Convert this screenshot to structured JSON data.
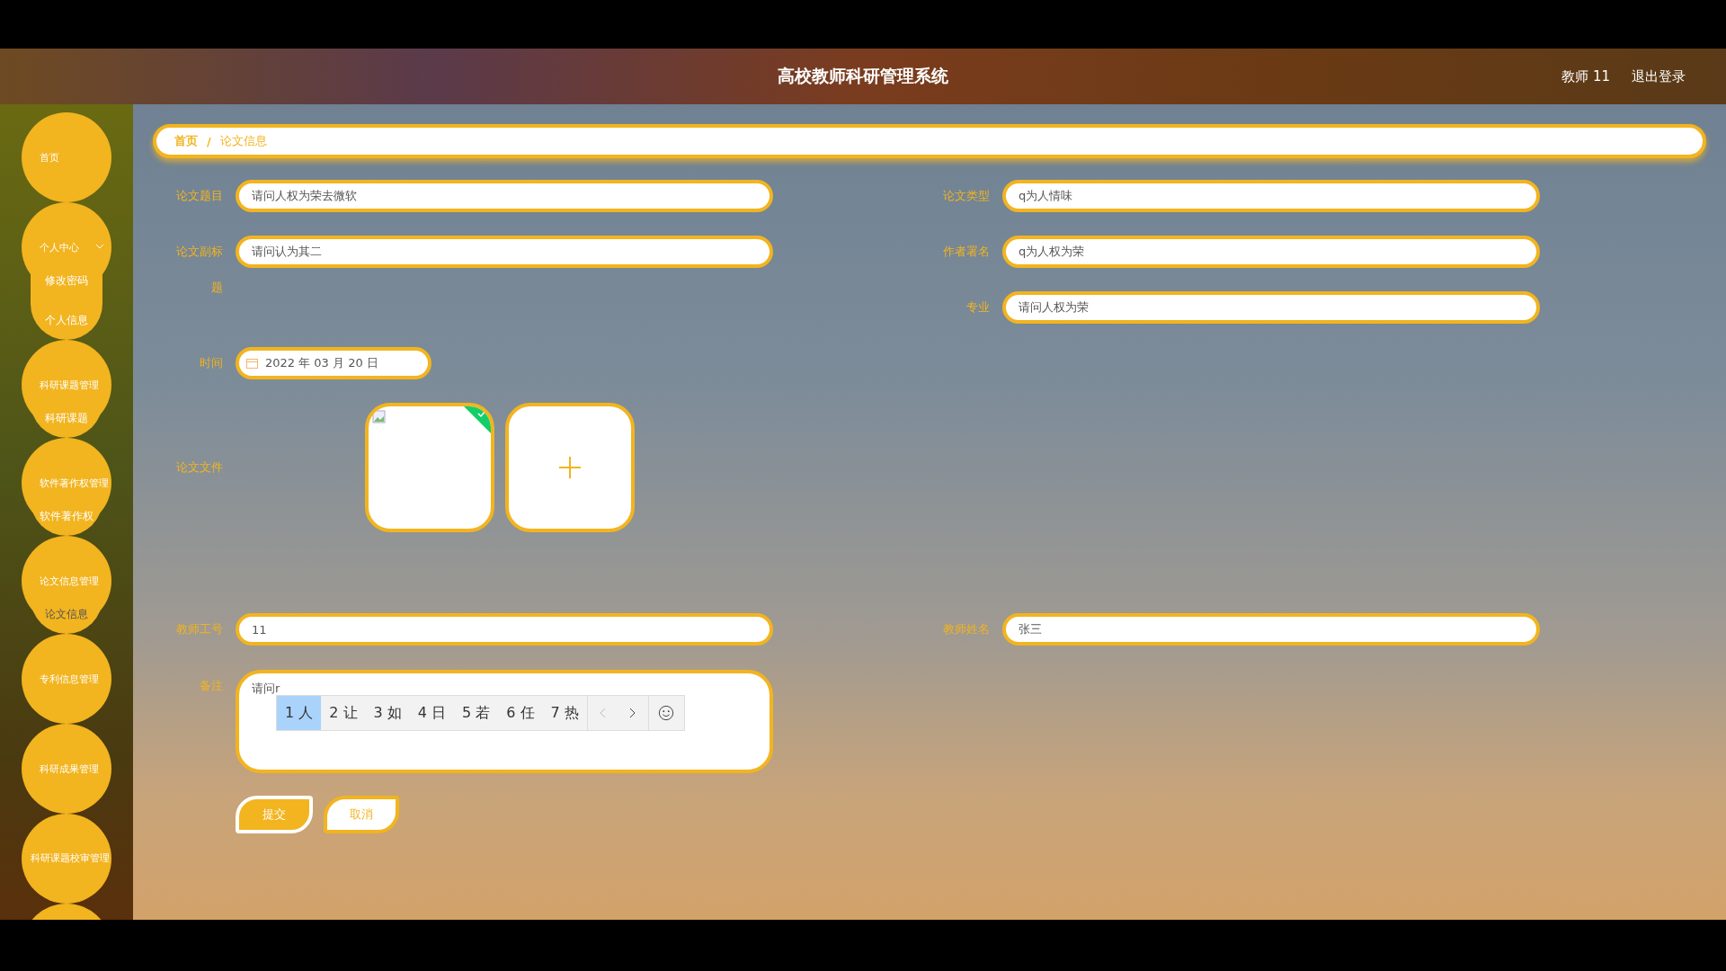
{
  "header": {
    "title": "高校教师科研管理系统",
    "user": "教师 11",
    "logout": "退出登录"
  },
  "sidebar": {
    "items": [
      {
        "label": "首页"
      },
      {
        "label": "个人中心",
        "expanded": true,
        "children": [
          {
            "label": "修改密码",
            "selected": false
          },
          {
            "label": "个人信息",
            "selected": false
          }
        ]
      },
      {
        "label": "科研课题管理",
        "expanded": true,
        "children": [
          {
            "label": "科研课题",
            "selected": false
          }
        ]
      },
      {
        "label": "软件著作权管理",
        "expanded": true,
        "children": [
          {
            "label": "软件著作权",
            "selected": false
          }
        ]
      },
      {
        "label": "论文信息管理",
        "expanded": true,
        "children": [
          {
            "label": "论文信息",
            "selected": true
          }
        ]
      },
      {
        "label": "专利信息管理"
      },
      {
        "label": "科研成果管理"
      },
      {
        "label": "科研课题校审管理"
      }
    ]
  },
  "breadcrumb": {
    "items": [
      "首页",
      "论文信息"
    ],
    "separator": "/"
  },
  "form": {
    "rows": [
      [
        {
          "label": "论文题目",
          "value": "请问人权为荣去微软"
        },
        {
          "label": "论文类型",
          "value": "q为人情味"
        }
      ],
      [
        {
          "label": "论文副标题",
          "value": "请问认为其二"
        },
        {
          "label": "作者署名",
          "value": "q为人权为荣"
        }
      ],
      [
        null,
        {
          "label": "专业",
          "value": "请问人权为荣"
        }
      ]
    ],
    "date": {
      "label": "时间",
      "value": "2022 年 03 月 20 日"
    },
    "file": {
      "label": "论文文件",
      "uploaded": true
    },
    "rows2": [
      [
        {
          "label": "教师工号",
          "value": "11"
        },
        {
          "label": "教师姓名",
          "value": "张三"
        }
      ]
    ],
    "remark": {
      "label": "备注",
      "value": "请问r"
    },
    "ime_candidates": [
      {
        "label": "1 人",
        "selected": true
      },
      {
        "label": "2 让",
        "selected": false
      },
      {
        "label": "3 如",
        "selected": false
      },
      {
        "label": "4 日",
        "selected": false
      },
      {
        "label": "5 若",
        "selected": false
      },
      {
        "label": "6 任",
        "selected": false
      },
      {
        "label": "7 热",
        "selected": false
      }
    ],
    "buttons": [
      {
        "label": "提交",
        "kind": "primary"
      },
      {
        "label": "取消",
        "kind": "secondary"
      }
    ]
  }
}
